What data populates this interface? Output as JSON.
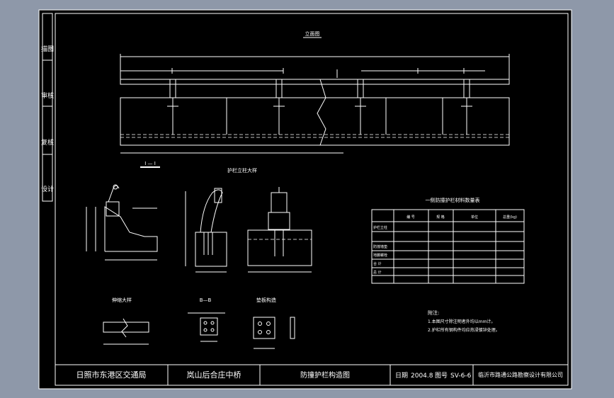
{
  "sheet": {
    "side_stamps": [
      "描图",
      "审核",
      "复核",
      "设计"
    ],
    "elevation_title": "立面图",
    "section_label": "I — I",
    "detail_title": "护栏立柱大样",
    "splice_title": "伸缩大样",
    "section_b_label": "B—B",
    "plate_title": "垫板构造",
    "table_title": "一侧防撞护栏材料数量表",
    "table_headers": [
      "编 号",
      "规 格",
      "单位",
      "数量",
      "总重(kg)"
    ],
    "table_row_labels": [
      "护栏立柱",
      "",
      "",
      "防撞墙垫",
      "地脚螺栓",
      "合 计",
      "总 计"
    ],
    "notes_title": "附注:",
    "notes": [
      "1.本图尺寸除注明者外均以mm计。",
      "2.护栏所有钢构件均应热浸镀锌处理。"
    ]
  },
  "title_block": {
    "org": "日照市东港区交通局",
    "project": "岚山后合庄中桥",
    "drawing": "防撞护栏构造图",
    "date_label": "日期",
    "date": "2004.8",
    "no_label": "图号",
    "number": "SV-6-6",
    "designer": "临沂市路通公路勘察设计有限公司"
  }
}
